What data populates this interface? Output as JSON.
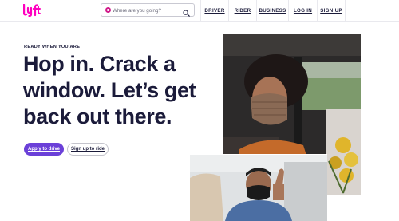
{
  "header": {
    "logo_text": "lyft",
    "search": {
      "placeholder": "Where are you going?"
    },
    "nav": {
      "driver": "DRIVER",
      "rider": "RIDER",
      "business": "BUSINESS",
      "login": "LOG IN",
      "signup": "SIGN UP"
    }
  },
  "hero": {
    "eyebrow": "READY WHEN YOU ARE",
    "headline_lines": [
      "Hop in. Crack a",
      "window. Let’s get",
      "back out there."
    ],
    "buttons": {
      "apply_to_drive": "Apply to drive",
      "sign_up_to_ride": "Sign up to ride"
    }
  },
  "colors": {
    "brand_pink": "#ff00bf",
    "primary_purple": "#6b40d8",
    "text_navy": "#1b1b3a"
  },
  "icons": {
    "logo": "lyft-logo-icon",
    "search": "magnifier-icon",
    "location": "pin-dot-icon"
  }
}
